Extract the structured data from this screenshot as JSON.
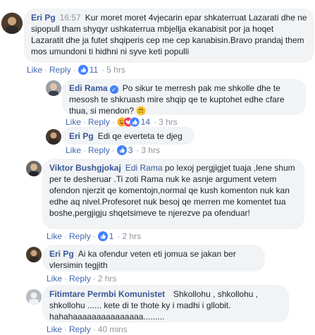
{
  "comments": [
    {
      "author": "Eri Pg",
      "time_inline": "16:57",
      "text": "Kur moret moret 4vjecarin epar shkaterruat Lazarati dhe ne sipopull tham shyqyr ushkaterrua mbjellja ekanabisit por ja hoqet Lazaratit dhe ja futet shqiperis cep me cep kanabisin.Bravo prandaj them mos umundoni ti hidhni ni syve keti populli",
      "like": "Like",
      "reply": "Reply",
      "reactions": "11",
      "time": "5 hrs"
    },
    {
      "author": "Edi Rama",
      "text": "Po sikur te merresh pak me shkolle dhe te mesosh te shkruash mire shqip qe te kuptohet edhe cfare thua, si mendon?",
      "like": "Like",
      "reply": "Reply",
      "reactions": "14",
      "time": "3 hrs"
    },
    {
      "author": "Eri Pg",
      "text": "Edi qe everteta te djeg",
      "like": "Like",
      "reply": "Reply",
      "reactions": "3",
      "time": "3 hrs"
    },
    {
      "author": "Viktor Bushgjokaj",
      "tag": "Edi Rama",
      "text": "po lexoj pergjigjet tuaja ,lene shum per te desheruar .Ti zoti Rama nuk ke asnje argument vetem ofendon njerzit qe komentojn,normal qe kush komenton nuk kan edhe aq nivel.Profesoret nuk besoj qe merren me komentet tua boshe,pergjigju shqetsimeve te njerezve pa ofenduar!",
      "like": "Like",
      "reply": "Reply",
      "reactions": "1",
      "time": "2 hrs"
    },
    {
      "author": "Eri Pg",
      "text": "Ai ka ofendur veten eti jomua se jakan ber vlersimin tegjith",
      "like": "Like",
      "reply": "Reply",
      "time": "2 hrs"
    },
    {
      "author": "Fitimtare Permbi Komunistet",
      "text": "Shkollohu , shkollohu , shkollohu ...... kete di te thote ky i madhi i gllobit. hahahaaaaaaaaaaaaaaa.........",
      "like": "Like",
      "reply": "Reply",
      "time": "40 mins"
    }
  ],
  "colors": {
    "link": "#385898",
    "action": "#4267b2",
    "meta": "#90949c",
    "bubble": "#f2f3f5",
    "like_blue": "#4080ff",
    "love_red": "#f33e58",
    "haha_yellow": "#f7b125"
  },
  "icons": {
    "like": "like-reaction-icon",
    "love": "love-reaction-icon",
    "haha": "haha-reaction-icon",
    "verified": "verified-badge-icon",
    "emoji": "upside-down-face-emoji"
  }
}
